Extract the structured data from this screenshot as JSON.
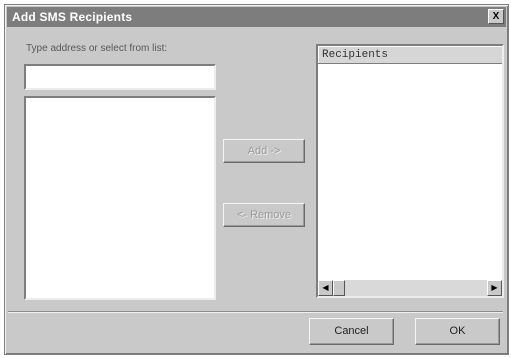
{
  "dialog": {
    "title": "Add SMS Recipients",
    "close_glyph": "X"
  },
  "address": {
    "label": "Type address or select from list:",
    "value": "",
    "placeholder": ""
  },
  "address_list": {
    "items": []
  },
  "buttons": {
    "add": "Add ->",
    "remove": "<- Remove",
    "cancel": "Cancel",
    "ok": "OK"
  },
  "recipients": {
    "header": "Recipients",
    "items": []
  },
  "scrollbar": {
    "left_arrow": "◀",
    "right_arrow": "▶"
  },
  "icons": [
    "close-icon",
    "scroll-left-icon",
    "scroll-right-icon"
  ]
}
